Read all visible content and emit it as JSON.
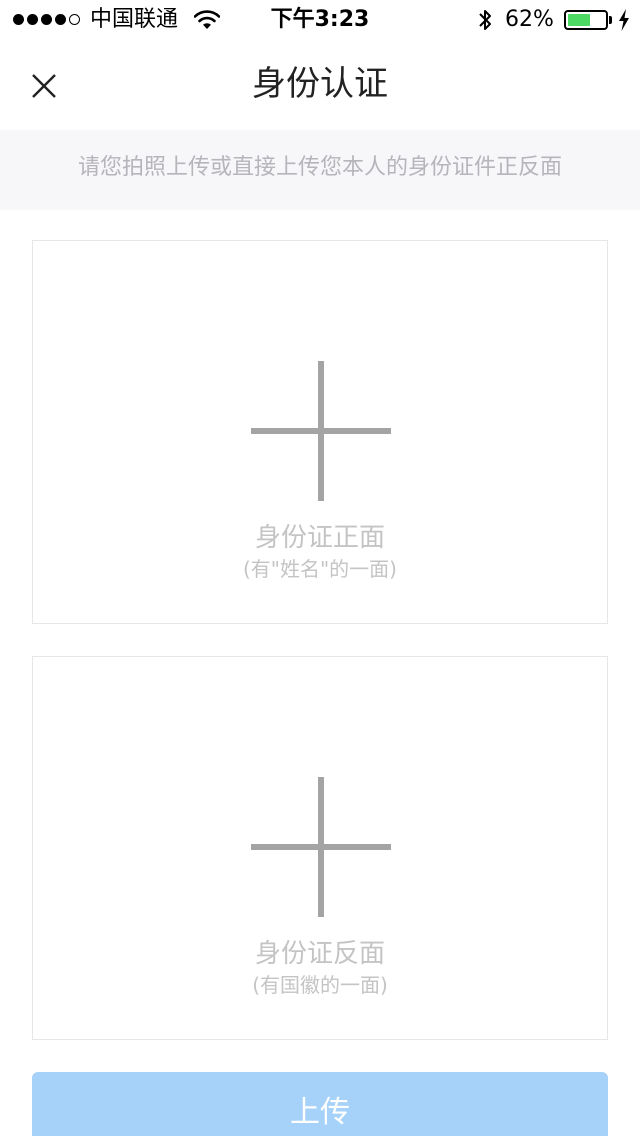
{
  "status_bar": {
    "carrier": "中国联通",
    "time": "下午3:23",
    "battery_percent": "62%",
    "battery_level": 0.62,
    "signal_bars_filled": 4,
    "signal_bars_total": 5,
    "battery_color": "#4cd964"
  },
  "nav": {
    "title": "身份认证",
    "close_icon": "close-icon"
  },
  "hint": {
    "text": "请您拍照上传或直接上传您本人的身份证件正反面"
  },
  "cards": {
    "front": {
      "label": "身份证正面",
      "sub": "(有\"姓名\"的一面)",
      "icon": "plus-icon"
    },
    "back": {
      "label": "身份证反面",
      "sub": "(有国徽的一面)",
      "icon": "plus-icon"
    }
  },
  "upload": {
    "label": "上传",
    "color": "#a6d2f9"
  }
}
